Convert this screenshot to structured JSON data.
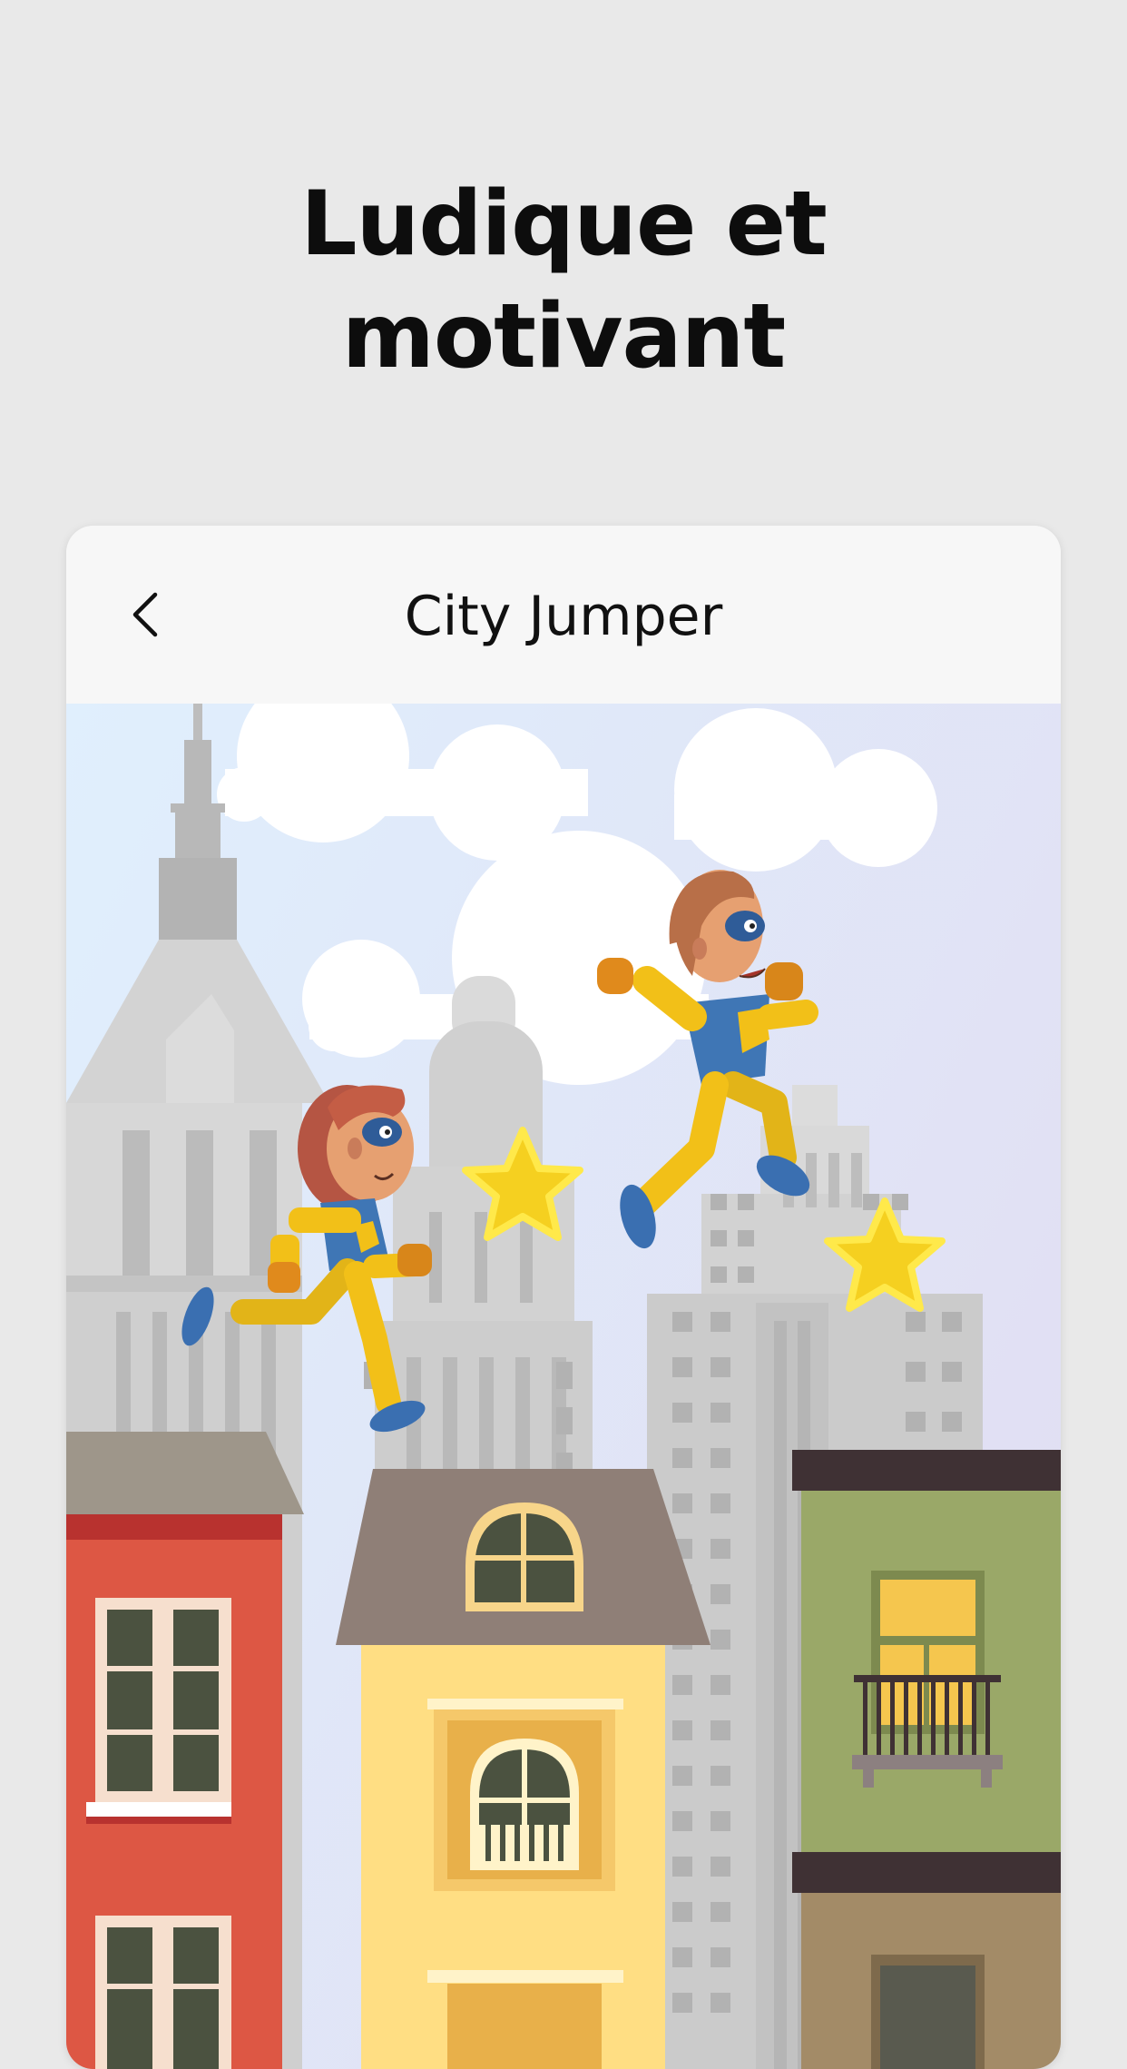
{
  "screen": {
    "headline_line1": "Ludique et",
    "headline_line2": "motivant"
  },
  "card": {
    "title": "City Jumper",
    "back_icon": "chevron-left-icon"
  },
  "scene": {
    "description_icons": [
      "cloud",
      "skyscraper",
      "superhero-girl",
      "superhero-boy",
      "star",
      "house"
    ],
    "colors": {
      "sky_top": "#dfeefd",
      "sky_right": "#e2dff4",
      "star": "#f5d020",
      "hero_suit": "#f2c018",
      "hero_shirt": "#3f76b5",
      "red_house": "#dd5744",
      "yellow_house": "#ffde83",
      "green_house": "#9aa868"
    }
  }
}
